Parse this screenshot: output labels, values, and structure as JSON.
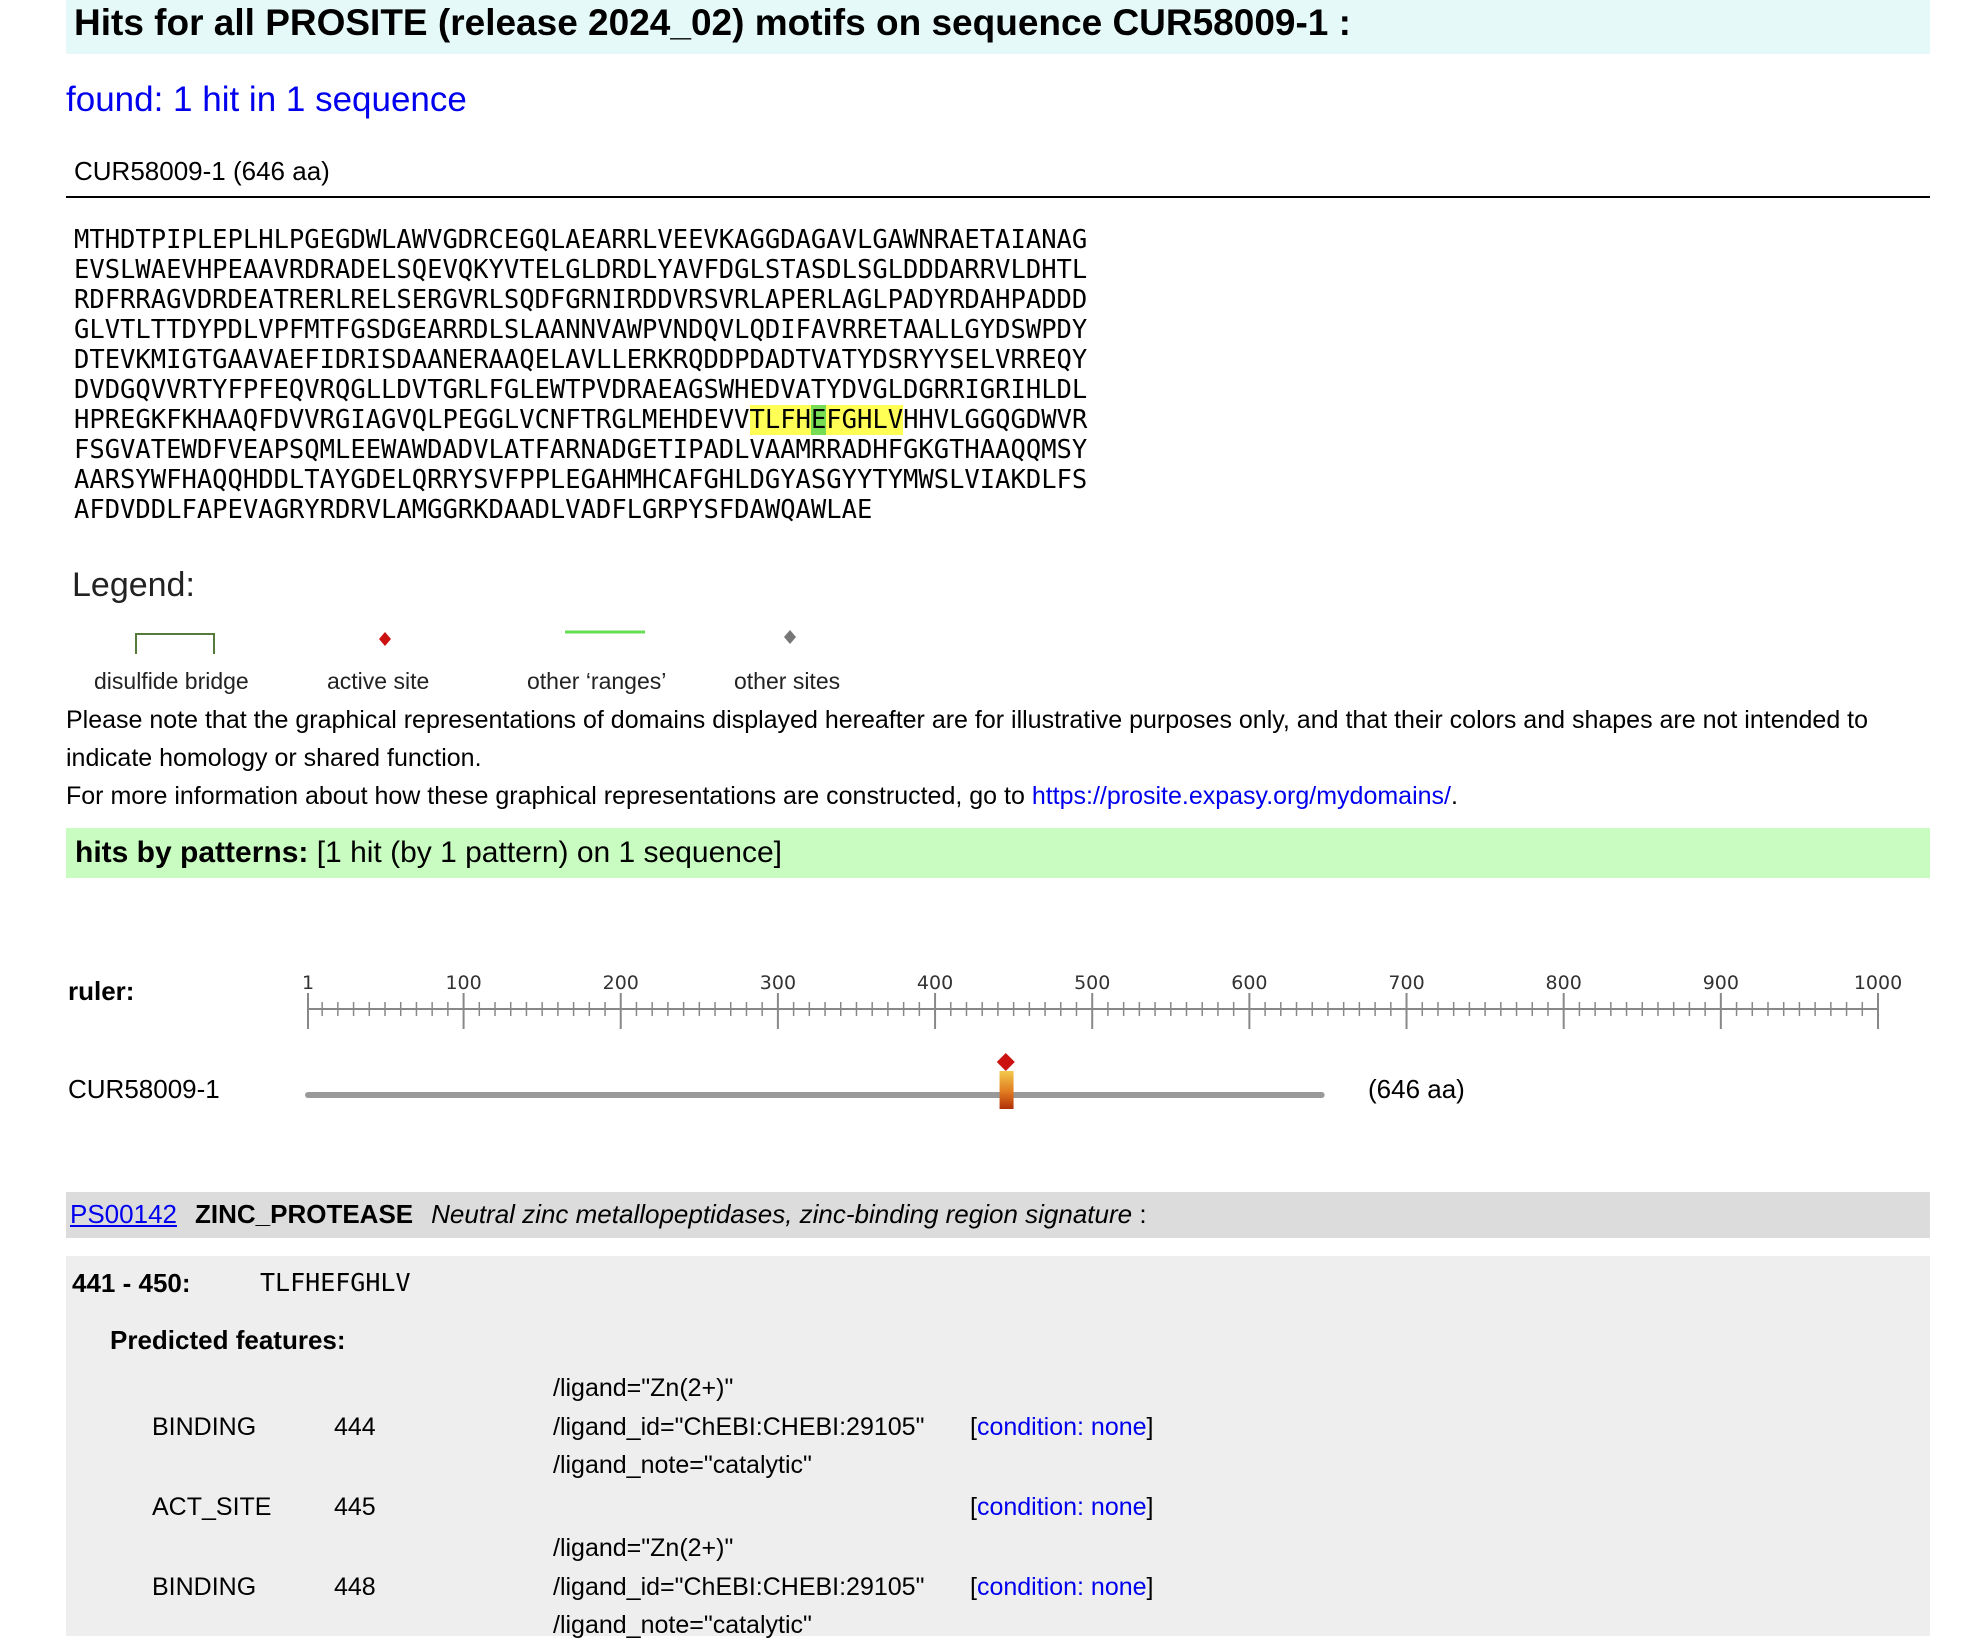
{
  "header": {
    "title": "Hits for all PROSITE (release 2024_02) motifs on sequence CUR58009-1 :",
    "found": "found: 1 hit in 1 sequence"
  },
  "sequence": {
    "header": "CUR58009-1 (646 aa)",
    "lines": [
      "MTHDTPIPLEPLHLPGEGDWLAWVGDRCEGQLAEARRLVEEVKAGGDAGAVLGAWNRAETAIANAG",
      "EVSLWAEVHPEAAVRDRADELSQEVQKYVTELGLDRDLYAVFDGLSTASDLSGLDDDARRVLDHTL",
      "RDFRRAGVDRDEATRERLRELSERGVRLSQDFGRNIRDDVRSVRLAPERLAGLPADYRDAHPADDD",
      "GLVTLTTDYPDLVPFMTFGSDGEARRDLSLAANNVAWPVNDQVLQDIFAVRRETAALLGYDSWPDY",
      "DTEVKMIGTGAAVAEFIDRISDAANERAAQELAVLLERKRQDDPDADTVATYDSRYYSELVRREQY",
      "DVDGQVVRTYFPFEQVRQGLLDVTGRLFGLEWTPVDRAEAGSWHEDVATYDVGLDGRRIGRIHLDL",
      "FSGVATEWDFVEAPSQMLEEWAWDADVLATFARNADGETIPADLVAAMRRADHFGKGTHAAQQMSY",
      "AARSYWFHAQQHDDLTAYGDELQRRYSVFPPLEGAHMHCAFGHLDGYASGYYTYMWSLVIAKDLFS",
      "AFDVDDLFAPEVAGRYRDRVLAMGGRKDAADLVADFLGRPYSFDAWQAWLAE"
    ],
    "line7": {
      "pre": "HPREGKFKHAAQFDVVRGIAGVQLPEGGLVCNFTRGLMEHDEVV",
      "hl1": "TLFH",
      "hl2": "E",
      "hl3": "FGHLV",
      "post": "HHVLGGQGDWVR"
    }
  },
  "legend": {
    "title": "Legend:",
    "items": [
      "disulfide bridge",
      "active site",
      "other ‘ranges’",
      "other sites"
    ]
  },
  "notes": {
    "line1": "Please note that the graphical representations of domains displayed hereafter are for illustrative purposes only, and that their colors and shapes are not intended to indicate homology or shared function.",
    "line2_prefix": "For more information about how these graphical representations are constructed, go to ",
    "line2_link": "https://prosite.expasy.org/mydomains/",
    "line2_suffix": "."
  },
  "patterns": {
    "label": "hits by patterns:",
    "summary": " [1 hit (by 1 pattern) on 1 sequence]"
  },
  "ruler": {
    "label": "ruler:",
    "max": 1000,
    "ticks": [
      "1",
      "100",
      "200",
      "300",
      "400",
      "500",
      "600",
      "700",
      "800",
      "900",
      "1000"
    ],
    "seq_name": "CUR58009-1",
    "seq_length_label": "(646 aa)",
    "seq_length": 646,
    "hit_start": 441,
    "hit_end": 450,
    "colors": {
      "active_site": "#cc1111",
      "hit": "#c84a10",
      "line": "#999999",
      "range": "#66dd55"
    }
  },
  "motif": {
    "accession": "PS00142",
    "name": "ZINC_PROTEASE",
    "description": "Neutral zinc metallopeptidases, zinc-binding region signature",
    "suffix": " :",
    "hit_range": "441 - 450:",
    "hit_seq": "TLFHEFGHLV",
    "features_title": "Predicted features:",
    "features": [
      {
        "type": "BINDING",
        "pos": "444",
        "notes": [
          "/ligand=\"Zn(2+)\"",
          "/ligand_id=\"ChEBI:CHEBI:29105\"",
          "/ligand_note=\"catalytic\""
        ],
        "condition": "condition: none"
      },
      {
        "type": "ACT_SITE",
        "pos": "445",
        "notes": [],
        "condition": "condition: none"
      },
      {
        "type": "BINDING",
        "pos": "448",
        "notes": [
          "/ligand=\"Zn(2+)\"",
          "/ligand_id=\"ChEBI:CHEBI:29105\"",
          "/ligand_note=\"catalytic\""
        ],
        "condition": "condition: none"
      }
    ]
  }
}
